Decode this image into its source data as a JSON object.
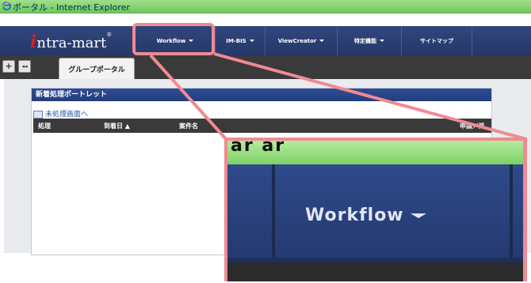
{
  "window": {
    "title": "ポータル - Internet Explorer"
  },
  "logo": {
    "prefix": "i",
    "text": "ntra-mart",
    "mark": "®"
  },
  "navbar": {
    "items": [
      {
        "label": "Workflow",
        "has_dropdown": true
      },
      {
        "label": "IM-BIS",
        "has_dropdown": true
      },
      {
        "label": "ViewCreator",
        "has_dropdown": true
      },
      {
        "label": "特定機能",
        "has_dropdown": true
      },
      {
        "label": "サイトマップ",
        "has_dropdown": false
      }
    ]
  },
  "tabs": {
    "add_button": "+",
    "collapse_button": "◂◂",
    "active_tab": "グループポータル"
  },
  "portlet": {
    "title": "新着処理ポートレット",
    "link": "未処理画面へ",
    "columns": [
      "処理",
      "到着日 ▲",
      "案件名",
      "申請／処"
    ]
  },
  "zoom": {
    "label": "Workflow",
    "top_text": "ar ar"
  },
  "colors": {
    "title_bar": "#7ed067",
    "navbar": "#2b4077",
    "highlight": "#f08a92",
    "portlet_header": "#2a4688"
  }
}
